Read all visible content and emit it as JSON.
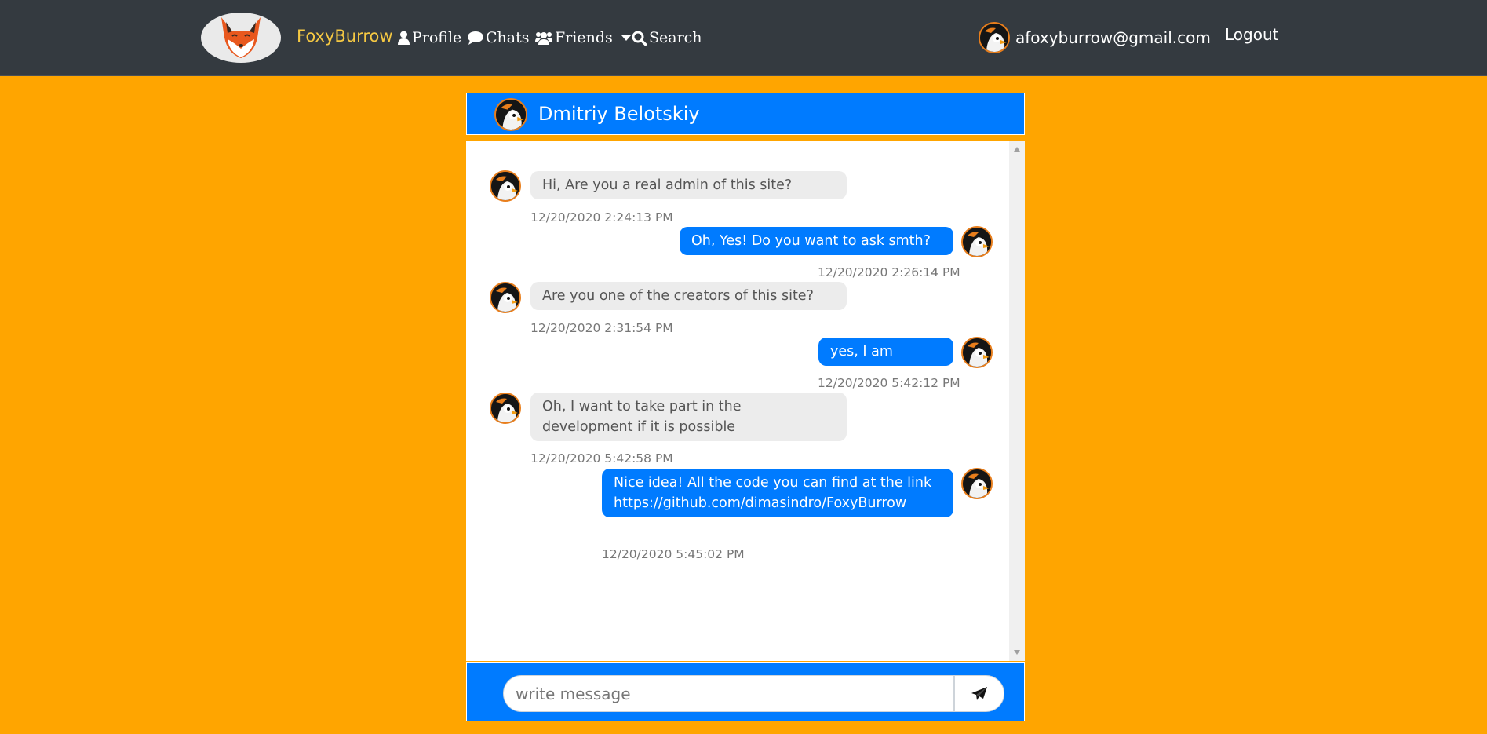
{
  "navbar": {
    "brand": "FoxyBurrow",
    "links": {
      "profile": "Profile",
      "chats": "Chats",
      "friends": "Friends",
      "search": "Search"
    },
    "user_email": "afoxyburrow@gmail.com",
    "logout": "Logout"
  },
  "chat": {
    "partner_name": "Dmitriy Belotskiy",
    "messages": [
      {
        "direction": "incoming",
        "text": "Hi, Are you a real admin of this site?",
        "time": "12/20/2020 2:24:13 PM"
      },
      {
        "direction": "outgoing",
        "text": "Oh, Yes! Do you want to ask smth?",
        "time": "12/20/2020 2:26:14 PM"
      },
      {
        "direction": "incoming",
        "text": "Are you one of the creators of this site?",
        "time": "12/20/2020 2:31:54 PM"
      },
      {
        "direction": "outgoing",
        "text": "yes, I am",
        "time": "12/20/2020 5:42:12 PM"
      },
      {
        "direction": "incoming",
        "text": "Oh, I want to take part in the development if it is possible",
        "time": "12/20/2020 5:42:58 PM"
      },
      {
        "direction": "outgoing",
        "text": "Nice idea! All the code you can find at the link https://github.com/dimasindro/FoxyBurrow",
        "time": "12/20/2020 5:45:02 PM"
      }
    ],
    "input": {
      "placeholder": "write message",
      "value": ""
    }
  },
  "icons": {
    "logo": "fox-logo",
    "profile": "user-icon",
    "chats": "comment-icon",
    "friends": "users-icon",
    "search": "search-icon",
    "send": "paper-plane-icon",
    "avatar": "penguin-avatar"
  },
  "colors": {
    "page_background": "#ffa500",
    "navbar": "#343a40",
    "brand": "#f5c843",
    "primary": "#007bff",
    "incoming_bubble": "#ececec"
  }
}
